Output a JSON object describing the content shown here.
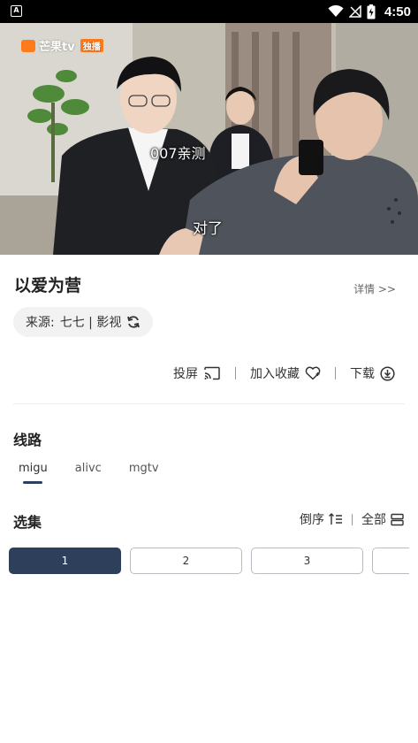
{
  "status_bar": {
    "time": "4:50",
    "notification_icon": "a-badge-icon",
    "icons": [
      "wifi-icon",
      "signal-off-icon",
      "battery-charging-icon"
    ]
  },
  "player": {
    "logo_text": "芒果tv",
    "logo_badge": "独播",
    "subtitle_top": "007亲测",
    "subtitle_bottom": "对了"
  },
  "video": {
    "title": "以爱为营",
    "details_label": "详情 >>"
  },
  "source": {
    "label": "来源:",
    "name": "七七 | 影视",
    "refresh_icon": "refresh-icon"
  },
  "actions": [
    {
      "label": "投屏",
      "icon": "cast-icon"
    },
    {
      "label": "加入收藏",
      "icon": "heart-icon"
    },
    {
      "label": "下载",
      "icon": "download-icon"
    }
  ],
  "lines_section": {
    "title": "线路",
    "tabs": [
      "migu",
      "alivc",
      "mgtv"
    ],
    "active_tab": "migu"
  },
  "episodes_section": {
    "title": "选集",
    "sort_label": "倒序",
    "all_label": "全部",
    "episodes": [
      "1",
      "2",
      "3",
      ""
    ],
    "active_episode": "1"
  },
  "colors": {
    "accent": "#2e3f5c"
  }
}
